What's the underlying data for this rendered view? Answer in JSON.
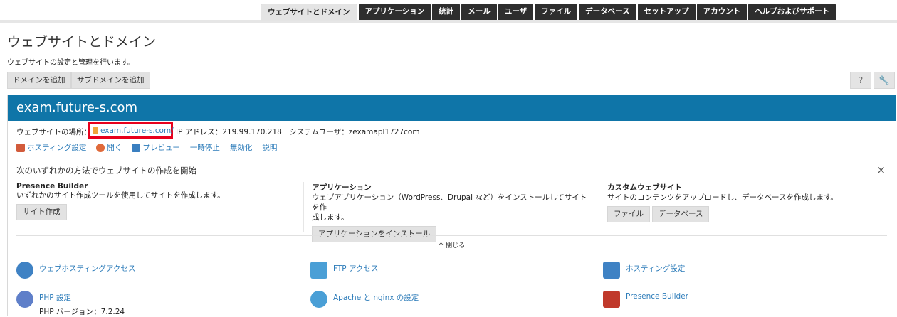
{
  "nav": {
    "tabs": [
      {
        "label": "ウェブサイトとドメイン",
        "active": true
      },
      {
        "label": "アプリケーション"
      },
      {
        "label": "統計"
      },
      {
        "label": "メール"
      },
      {
        "label": "ユーザ"
      },
      {
        "label": "ファイル"
      },
      {
        "label": "データベース"
      },
      {
        "label": "セットアップ"
      },
      {
        "label": "アカウント"
      },
      {
        "label": "ヘルプおよびサポート"
      }
    ]
  },
  "header": {
    "title": "ウェブサイトとドメイン",
    "subtitle": "ウェブサイトの設定と管理を行います。",
    "add_domain": "ドメインを追加",
    "add_subdomain": "サブドメインを追加",
    "help_label": "?",
    "tool_label": "🔧"
  },
  "domain": {
    "name": "exam.future-s.com",
    "location_label": "ウェブサイトの場所：",
    "location_link": "exam.future-s.com/",
    "ip_text": "IP アドレス：219.99.170.218　システムユーザ：zexamapl1727com",
    "actions": [
      {
        "label": "ホスティング設定",
        "icon": "hosting-settings-icon"
      },
      {
        "label": "開く",
        "icon": "open-icon"
      },
      {
        "label": "プレビュー",
        "icon": "preview-icon"
      },
      {
        "label": "一時停止"
      },
      {
        "label": "無効化"
      },
      {
        "label": "説明"
      }
    ]
  },
  "build": {
    "title": "次のいずれかの方法でウェブサイトの作成を開始",
    "close": "×",
    "columns": [
      {
        "heading": "Presence Builder",
        "desc": "いずれかのサイト作成ツールを使用してサイトを作成します。",
        "buttons": [
          "サイト作成"
        ]
      },
      {
        "heading": "アプリケーション",
        "desc": "ウェブアプリケーション（WordPress、Drupal など）をインストールしてサイトを作\n成します。",
        "buttons": [
          "アプリケーションをインストール"
        ]
      },
      {
        "heading": "カスタムウェブサイト",
        "desc": "サイトのコンテンツをアップロードし、データベースを作成します。",
        "buttons": [
          "ファイル",
          "データベース"
        ]
      }
    ],
    "collapse_label": "閉じる"
  },
  "features": [
    {
      "label": "ウェブホスティングアクセス",
      "icon": "web-hosting-access-icon",
      "color": "#3f82c4"
    },
    {
      "label": "FTP アクセス",
      "icon": "ftp-access-icon",
      "color": "#4a9fd6"
    },
    {
      "label": "ホスティング設定",
      "icon": "hosting-settings-icon",
      "color": "#3f82c4"
    },
    {
      "label": "PHP 設定",
      "sub": "PHP バージョン：7.2.24",
      "icon": "php-icon",
      "color": "#5f7fc9"
    },
    {
      "label": "Apache と nginx の設定",
      "icon": "apache-nginx-icon",
      "color": "#4a9fd6"
    },
    {
      "label": "Presence Builder",
      "icon": "presence-builder-icon",
      "color": "#c0392b"
    }
  ],
  "colors": {
    "accent": "#0f75a8",
    "link": "#2b7bb9",
    "highlight": "#e8001c"
  }
}
